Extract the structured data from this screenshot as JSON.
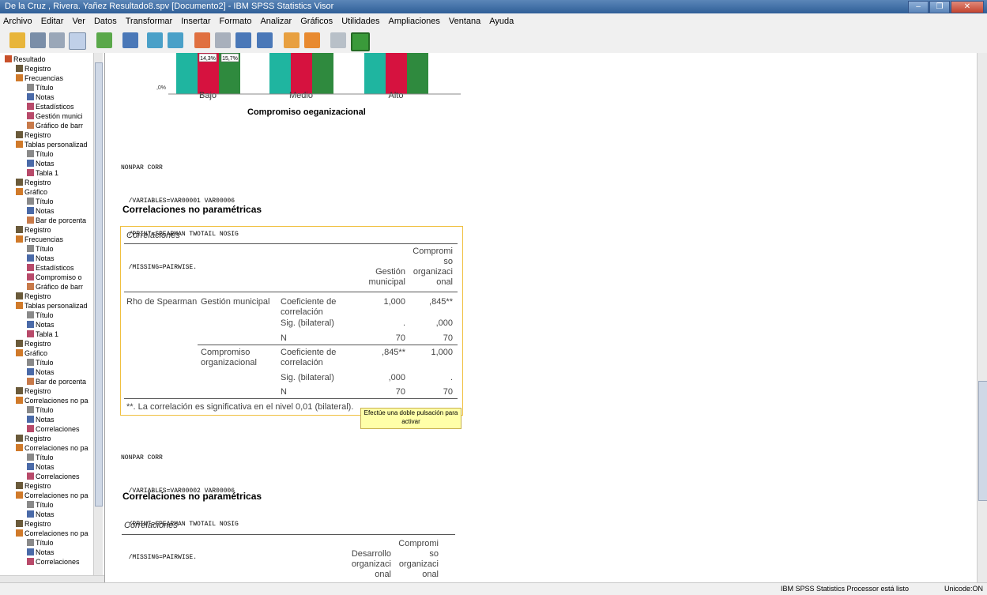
{
  "window": {
    "title": "De la Cruz , Rivera. Yañez Resultado8.spv [Documento2] - IBM SPSS Statistics Visor",
    "min": "–",
    "max": "❐",
    "close": "✕"
  },
  "menu": [
    "Archivo",
    "Editar",
    "Ver",
    "Datos",
    "Transformar",
    "Insertar",
    "Formato",
    "Analizar",
    "Gráficos",
    "Utilidades",
    "Ampliaciones",
    "Ventana",
    "Ayuda"
  ],
  "toolbar_icons": [
    "open-icon",
    "save-icon",
    "print-icon",
    "preview-icon",
    "export-icon",
    "recall-dialog-icon",
    "undo-icon",
    "redo-icon",
    "goto-data-icon",
    "goto-case-icon",
    "goto-variable-icon",
    "variables-icon",
    "show-all-icon",
    "designated-window-icon",
    "hide-icon",
    "promote-icon"
  ],
  "tree": [
    {
      "label": "Resultado",
      "level": 0,
      "icon": "output-icon"
    },
    {
      "label": "Registro",
      "level": 1,
      "icon": "log-icon"
    },
    {
      "label": "Frecuencias",
      "level": 1,
      "icon": "procedure-icon"
    },
    {
      "label": "Título",
      "level": 2,
      "icon": "title-icon"
    },
    {
      "label": "Notas",
      "level": 2,
      "icon": "notes-icon"
    },
    {
      "label": "Estadísticos",
      "level": 2,
      "icon": "table-icon"
    },
    {
      "label": "Gestión munici",
      "level": 2,
      "icon": "table-icon"
    },
    {
      "label": "Gráfico de barr",
      "level": 2,
      "icon": "chart-icon"
    },
    {
      "label": "Registro",
      "level": 1,
      "icon": "log-icon"
    },
    {
      "label": "Tablas personalizad",
      "level": 1,
      "icon": "procedure-icon"
    },
    {
      "label": "Título",
      "level": 2,
      "icon": "title-icon"
    },
    {
      "label": "Notas",
      "level": 2,
      "icon": "notes-icon"
    },
    {
      "label": "Tabla 1",
      "level": 2,
      "icon": "table-icon"
    },
    {
      "label": "Registro",
      "level": 1,
      "icon": "log-icon"
    },
    {
      "label": "Gráfico",
      "level": 1,
      "icon": "procedure-icon"
    },
    {
      "label": "Título",
      "level": 2,
      "icon": "title-icon"
    },
    {
      "label": "Notas",
      "level": 2,
      "icon": "notes-icon"
    },
    {
      "label": "Bar de porcenta",
      "level": 2,
      "icon": "chart-icon"
    },
    {
      "label": "Registro",
      "level": 1,
      "icon": "log-icon"
    },
    {
      "label": "Frecuencias",
      "level": 1,
      "icon": "procedure-icon"
    },
    {
      "label": "Título",
      "level": 2,
      "icon": "title-icon"
    },
    {
      "label": "Notas",
      "level": 2,
      "icon": "notes-icon"
    },
    {
      "label": "Estadísticos",
      "level": 2,
      "icon": "table-icon"
    },
    {
      "label": "Compromiso o",
      "level": 2,
      "icon": "table-icon"
    },
    {
      "label": "Gráfico de barr",
      "level": 2,
      "icon": "chart-icon"
    },
    {
      "label": "Registro",
      "level": 1,
      "icon": "log-icon"
    },
    {
      "label": "Tablas personalizad",
      "level": 1,
      "icon": "procedure-icon"
    },
    {
      "label": "Título",
      "level": 2,
      "icon": "title-icon"
    },
    {
      "label": "Notas",
      "level": 2,
      "icon": "notes-icon"
    },
    {
      "label": "Tabla 1",
      "level": 2,
      "icon": "table-icon"
    },
    {
      "label": "Registro",
      "level": 1,
      "icon": "log-icon"
    },
    {
      "label": "Gráfico",
      "level": 1,
      "icon": "procedure-icon"
    },
    {
      "label": "Título",
      "level": 2,
      "icon": "title-icon"
    },
    {
      "label": "Notas",
      "level": 2,
      "icon": "notes-icon"
    },
    {
      "label": "Bar de porcenta",
      "level": 2,
      "icon": "chart-icon"
    },
    {
      "label": "Registro",
      "level": 1,
      "icon": "log-icon"
    },
    {
      "label": "Correlaciones no pa",
      "level": 1,
      "icon": "procedure-icon"
    },
    {
      "label": "Título",
      "level": 2,
      "icon": "title-icon"
    },
    {
      "label": "Notas",
      "level": 2,
      "icon": "notes-icon"
    },
    {
      "label": "Correlaciones",
      "level": 2,
      "icon": "table-icon"
    },
    {
      "label": "Registro",
      "level": 1,
      "icon": "log-icon"
    },
    {
      "label": "Correlaciones no pa",
      "level": 1,
      "icon": "procedure-icon"
    },
    {
      "label": "Título",
      "level": 2,
      "icon": "title-icon"
    },
    {
      "label": "Notas",
      "level": 2,
      "icon": "notes-icon"
    },
    {
      "label": "Correlaciones",
      "level": 2,
      "icon": "table-icon"
    },
    {
      "label": "Registro",
      "level": 1,
      "icon": "log-icon"
    },
    {
      "label": "Correlaciones no pa",
      "level": 1,
      "icon": "procedure-icon"
    },
    {
      "label": "Título",
      "level": 2,
      "icon": "title-icon"
    },
    {
      "label": "Notas",
      "level": 2,
      "icon": "notes-icon"
    },
    {
      "label": "Registro",
      "level": 1,
      "icon": "log-icon"
    },
    {
      "label": "Correlaciones no pa",
      "level": 1,
      "icon": "procedure-icon"
    },
    {
      "label": "Título",
      "level": 2,
      "icon": "title-icon"
    },
    {
      "label": "Notas",
      "level": 2,
      "icon": "notes-icon"
    },
    {
      "label": "Correlaciones",
      "level": 2,
      "icon": "table-icon"
    }
  ],
  "chart": {
    "categories": [
      "Bajo",
      "Medio",
      "Alto"
    ],
    "series_colors": [
      "#1fb5a0",
      "#d6123f",
      "#2f8a3e"
    ],
    "visible_labels": [
      "14,3%",
      "15,7%"
    ],
    "y_tick": ",0%",
    "xlabel": "Compromiso oeganizacional"
  },
  "syntax1": [
    "NONPAR CORR",
    "  /VARIABLES=VAR00001 VAR00006",
    "  /PRINT=SPEARMAN TWOTAIL NOSIG",
    "  /MISSING=PAIRWISE."
  ],
  "heading1": "Correlaciones no paramétricas",
  "table1": {
    "title": "Correlaciones",
    "col1_header": [
      "Gestión",
      "municipal"
    ],
    "col2_header": [
      "Compromi",
      "so",
      "organizaci",
      "onal"
    ],
    "rho": "Rho de Spearman",
    "var1": "Gestión municipal",
    "var2": [
      "Compromiso",
      "organizacional"
    ],
    "coef": [
      "Coeficiente de",
      "correlación"
    ],
    "sig": "Sig. (bilateral)",
    "n": "N",
    "r1": [
      "1,000",
      ",845**"
    ],
    "r2": [
      ".",
      ",000"
    ],
    "r3": [
      "70",
      "70"
    ],
    "r4": [
      ",845**",
      "1,000"
    ],
    "r5": [
      ",000",
      "."
    ],
    "r6": [
      "70",
      "70"
    ],
    "footnote": "**. La correlación es significativa en el nivel 0,01 (bilateral).",
    "tooltip": [
      "Efectúe una doble pulsación para",
      "activar"
    ]
  },
  "syntax2": [
    "NONPAR CORR",
    "  /VARIABLES=VAR00002 VAR00006",
    "  /PRINT=SPEARMAN TWOTAIL NOSIG",
    "  /MISSING=PAIRWISE."
  ],
  "heading2": "Correlaciones no paramétricas",
  "table2": {
    "title": "Correlaciones",
    "col1_header": [
      "Desarrollo",
      "organizaci",
      "onal"
    ],
    "col2_header": [
      "Compromi",
      "so",
      "organizaci",
      "onal"
    ]
  },
  "status": {
    "processor": "IBM SPSS Statistics Processor está listo",
    "unicode": "Unicode:ON"
  }
}
